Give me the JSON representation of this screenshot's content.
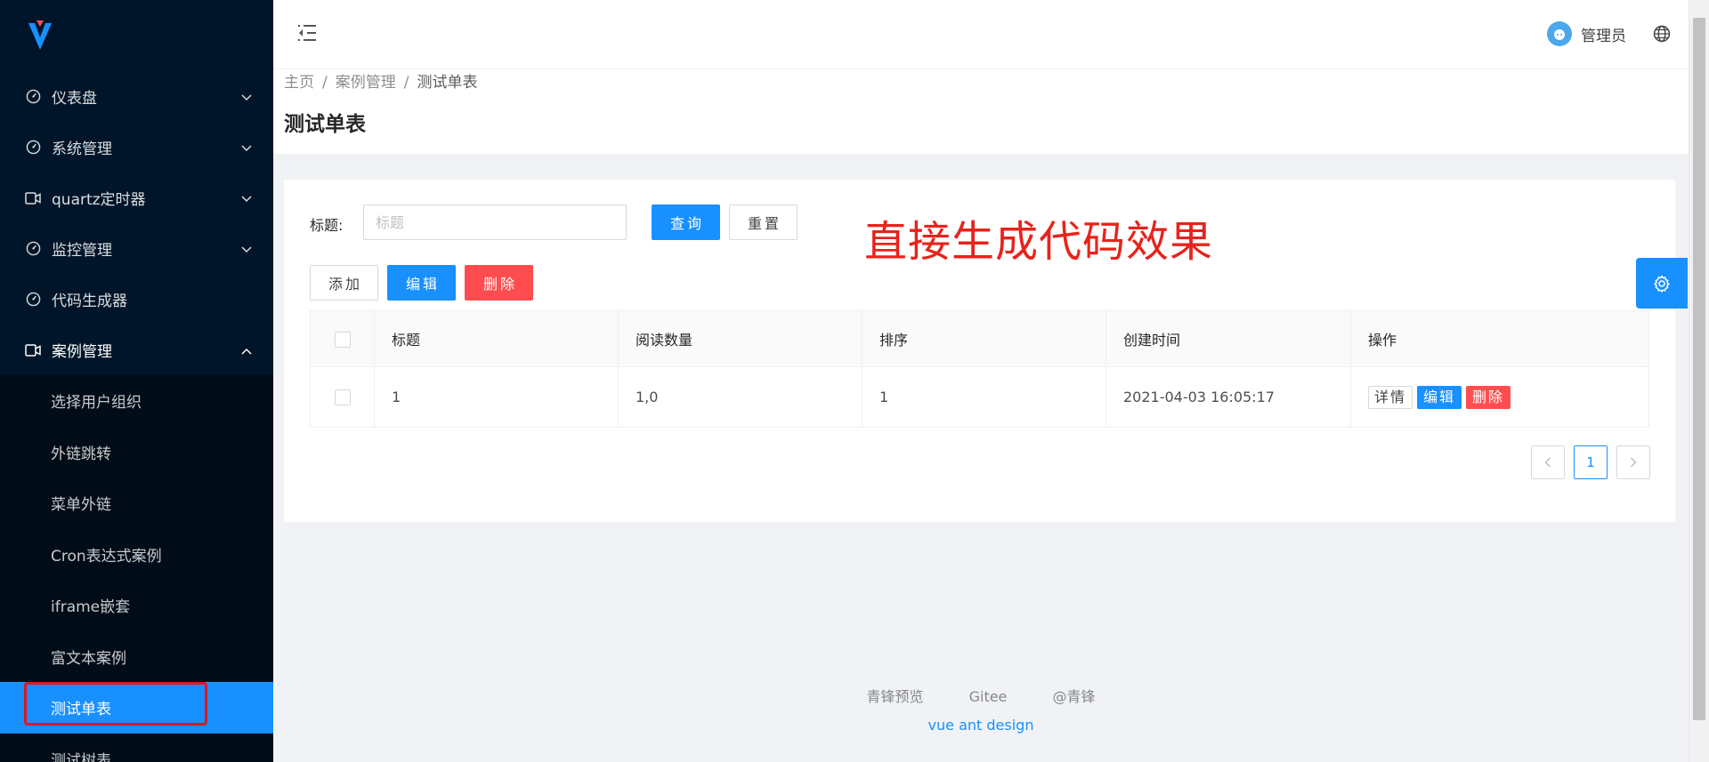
{
  "header": {
    "user_name": "管理员"
  },
  "sidebar": {
    "items": [
      {
        "label": "仪表盘",
        "icon": "dashboard-icon"
      },
      {
        "label": "系统管理",
        "icon": "dashboard-icon"
      },
      {
        "label": "quartz定时器",
        "icon": "video-camera-icon"
      },
      {
        "label": "监控管理",
        "icon": "dashboard-icon"
      },
      {
        "label": "代码生成器",
        "icon": "dashboard-icon"
      },
      {
        "label": "案例管理",
        "icon": "video-camera-icon"
      }
    ],
    "subitems": [
      {
        "label": "选择用户组织"
      },
      {
        "label": "外链跳转"
      },
      {
        "label": "菜单外链"
      },
      {
        "label": "Cron表达式案例"
      },
      {
        "label": "iframe嵌套"
      },
      {
        "label": "富文本案例"
      },
      {
        "label": "测试单表"
      },
      {
        "label": "测试树表"
      }
    ]
  },
  "breadcrumb": [
    "主页",
    "案例管理",
    "测试单表"
  ],
  "page": {
    "title": "测试单表"
  },
  "search": {
    "label": "标题:",
    "placeholder": "标题",
    "value": "",
    "query_label": "查询",
    "reset_label": "重置"
  },
  "toolbar": {
    "add_label": "添加",
    "edit_label": "编辑",
    "delete_label": "删除"
  },
  "annotation": "直接生成代码效果",
  "table": {
    "columns": [
      "标题",
      "阅读数量",
      "排序",
      "创建时间",
      "操作"
    ],
    "rows": [
      {
        "title": "1",
        "read_count": "1,0",
        "sort": "1",
        "created": "2021-04-03 16:05:17",
        "actions": [
          "详情",
          "编辑",
          "删除"
        ]
      }
    ]
  },
  "pagination": {
    "current": "1"
  },
  "footer": {
    "links": [
      "青锋预览",
      "Gitee",
      "@青锋"
    ],
    "copyright": "vue ant design"
  },
  "colors": {
    "sider_bg": "#001529",
    "primary": "#1890ff",
    "danger": "#ff4d4f",
    "annotation_red": "#e8231b"
  }
}
